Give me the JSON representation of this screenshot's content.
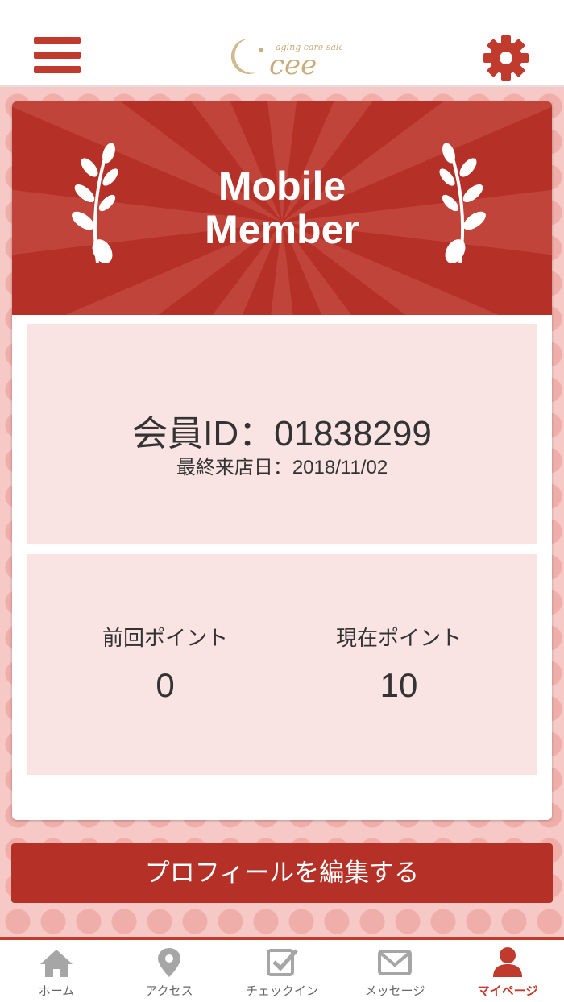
{
  "header": {
    "logo_text": "cee",
    "logo_tagline": "aging care salon",
    "menu_icon": "hamburger-menu-icon",
    "settings_icon": "gear-icon"
  },
  "member_card": {
    "title_line1": "Mobile",
    "title_line2": "Member",
    "member_id_text": "会員ID：01838299",
    "last_visit_text": "最終来店日：2018/11/02",
    "previous_points_label": "前回ポイント",
    "previous_points_value": "0",
    "current_points_label": "現在ポイント",
    "current_points_value": "10"
  },
  "edit_profile_button": "プロフィールを編集する",
  "tabs": [
    {
      "label": "ホーム",
      "icon": "home-icon",
      "active": false
    },
    {
      "label": "アクセス",
      "icon": "map-pin-icon",
      "active": false
    },
    {
      "label": "チェックイン",
      "icon": "checkbox-icon",
      "active": false
    },
    {
      "label": "メッセージ",
      "icon": "envelope-icon",
      "active": false
    },
    {
      "label": "マイページ",
      "icon": "user-icon",
      "active": true
    }
  ],
  "colors": {
    "accent": "#c03a2e",
    "banner": "#b53127",
    "panel_background": "#f9e3e3",
    "page_background": "#f6c9c6",
    "inactive_icon": "#a6a6a6"
  }
}
